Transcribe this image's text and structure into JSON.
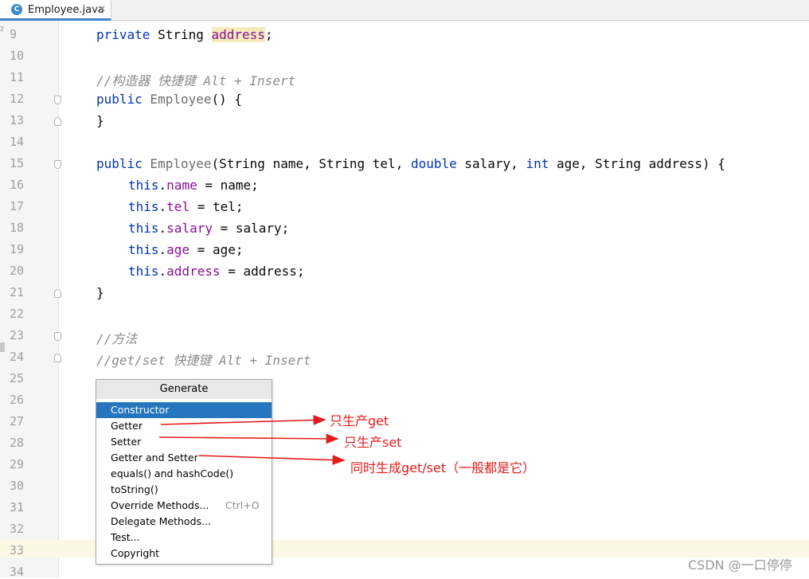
{
  "tab": {
    "icon": "C",
    "filename": "Employee.java",
    "close": "✕",
    "gutter_mark": "2"
  },
  "code_lines": [
    {
      "no": "9"
    },
    {
      "no": "10"
    },
    {
      "no": "11"
    },
    {
      "no": "12"
    },
    {
      "no": "13"
    },
    {
      "no": "14"
    },
    {
      "no": "15"
    },
    {
      "no": "16"
    },
    {
      "no": "17"
    },
    {
      "no": "18"
    },
    {
      "no": "19"
    },
    {
      "no": "20"
    },
    {
      "no": "21"
    },
    {
      "no": "22"
    },
    {
      "no": "23"
    },
    {
      "no": "24"
    },
    {
      "no": "25"
    },
    {
      "no": "26"
    },
    {
      "no": "27"
    },
    {
      "no": "28"
    },
    {
      "no": "29"
    },
    {
      "no": "30"
    },
    {
      "no": "31"
    },
    {
      "no": "32"
    },
    {
      "no": "33"
    },
    {
      "no": "34"
    }
  ],
  "code": {
    "l9": {
      "kw": "private",
      "type": " String ",
      "field": "address",
      "end": ";"
    },
    "l11": {
      "comment": "//构造器 快捷键 Alt + Insert"
    },
    "l12": {
      "kw": "public",
      "name": " Employee",
      "rest": "() {"
    },
    "l13": {
      "text": "}"
    },
    "l15": {
      "kw1": "public",
      "name": " Employee",
      "p1": "(String name, String tel, ",
      "kw2": "double",
      "p2": " salary, ",
      "kw3": "int",
      "p3": " age, String address) {"
    },
    "l16": {
      "this": "this",
      "dot": ".",
      "field": "name",
      "rest": " = name;"
    },
    "l17": {
      "this": "this",
      "dot": ".",
      "field": "tel",
      "rest": " = tel;"
    },
    "l18": {
      "this": "this",
      "dot": ".",
      "field": "salary",
      "rest": " = salary;"
    },
    "l19": {
      "this": "this",
      "dot": ".",
      "field": "age",
      "rest": " = age;"
    },
    "l20": {
      "this": "this",
      "dot": ".",
      "field": "address",
      "rest": " = address;"
    },
    "l21": {
      "text": "}"
    },
    "l23": {
      "comment": "//方法"
    },
    "l24": {
      "comment": "//get/set 快捷键 Alt + Insert"
    }
  },
  "popup": {
    "title": "Generate",
    "items": [
      {
        "label": "Constructor",
        "shortcut": "",
        "selected": true
      },
      {
        "label": "Getter",
        "shortcut": ""
      },
      {
        "label": "Setter",
        "shortcut": ""
      },
      {
        "label": "Getter and Setter",
        "shortcut": ""
      },
      {
        "label": "equals() and hashCode()",
        "shortcut": ""
      },
      {
        "label": "toString()",
        "shortcut": ""
      },
      {
        "label": "Override Methods...",
        "shortcut": "Ctrl+O"
      },
      {
        "label": "Delegate Methods...",
        "shortcut": ""
      },
      {
        "label": "Test...",
        "shortcut": ""
      },
      {
        "label": "Copyright",
        "shortcut": ""
      }
    ]
  },
  "annotations": {
    "getter": "只生产get",
    "setter": "只生产set",
    "getter_setter": "同时生成get/set（一般都是它）",
    "color": "#e51c1c"
  },
  "watermark": "CSDN @一口停停",
  "colors": {
    "keyword": "#0033b3",
    "field": "#871094",
    "comment": "#8c8c8c",
    "selection": "#2675bf"
  }
}
